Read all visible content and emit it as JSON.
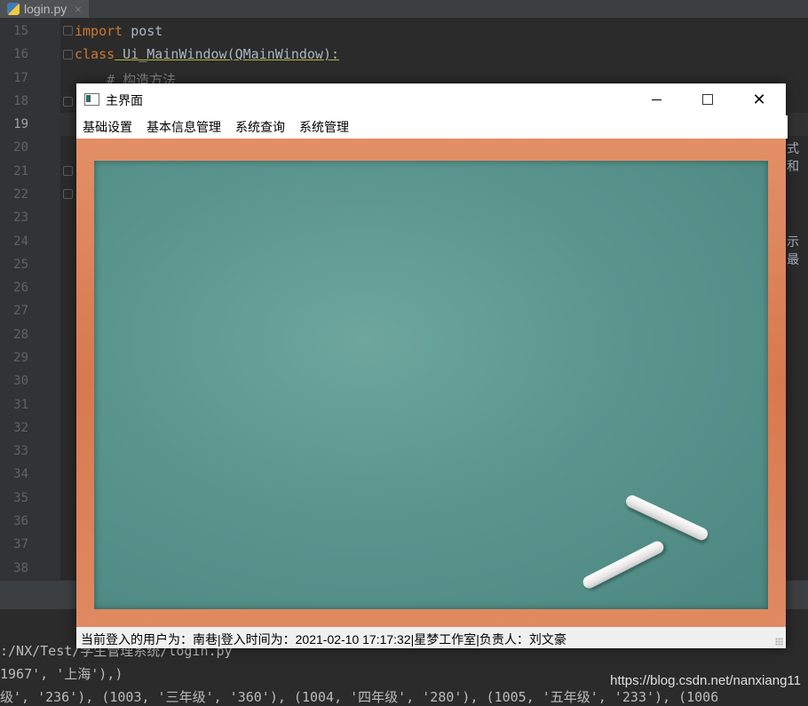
{
  "ide": {
    "tab": {
      "filename": "login.py",
      "close": "×"
    },
    "line_numbers": [
      "15",
      "16",
      "17",
      "18",
      "19",
      "20",
      "21",
      "22",
      "23",
      "24",
      "25",
      "26",
      "27",
      "28",
      "29",
      "30",
      "31",
      "32",
      "33",
      "34",
      "35",
      "36",
      "37",
      "38"
    ],
    "code": {
      "line15_kw": "import",
      "line15_rest": " post",
      "line16_kw": "class",
      "line16_rest": " Ui_MainWindow(QMainWindow):",
      "line17_comment": "    # 构造方法"
    },
    "side_fragments": {
      "line20": "式和",
      "line24": "示最"
    },
    "console": {
      "line1": ":/NX/Test/学生管理系统/login.py",
      "line2": "1967', '上海'),)",
      "line3": "级', '236'), (1003, '三年级', '360'), (1004, '四年级', '280'), (1005, '五年级', '233'), (1006"
    },
    "watermark": "https://blog.csdn.net/nanxiang11"
  },
  "window": {
    "title": "主界面",
    "icon": "window-app-icon",
    "controls": {
      "minimize": "minimize-icon",
      "maximize": "maximize-icon",
      "close": "✕"
    },
    "menu": [
      {
        "label": "基础设置"
      },
      {
        "label": "基本信息管理"
      },
      {
        "label": "系统查询"
      },
      {
        "label": "系统管理"
      }
    ],
    "status_text": "当前登入的用户为：南巷|登入时间为：2021-02-10 17:17:32|星梦工作室|负责人：刘文豪"
  },
  "colors": {
    "board": "#5a958e",
    "frame": "#df8760",
    "ide_bg": "#2b2b2b"
  }
}
